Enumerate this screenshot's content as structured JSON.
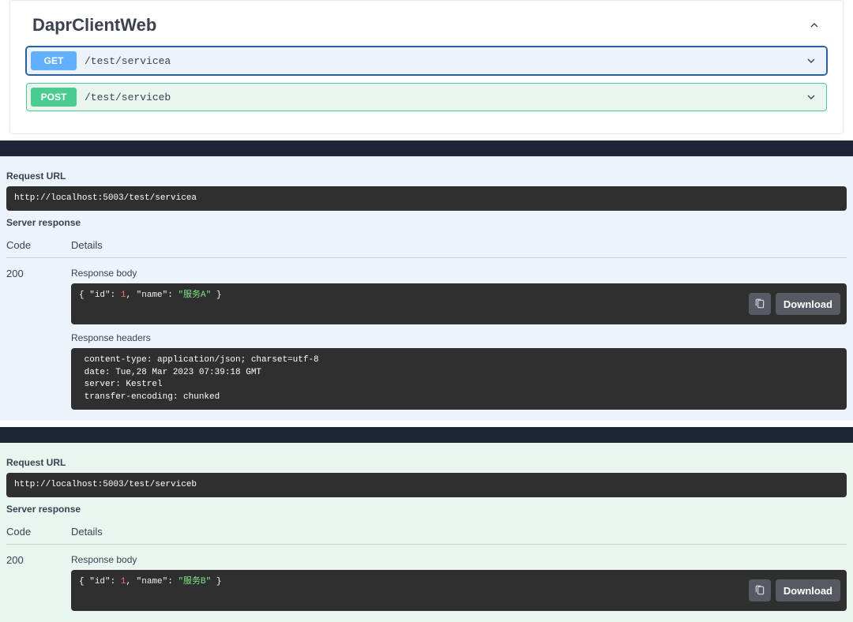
{
  "section": {
    "title": "DaprClientWeb"
  },
  "ops": [
    {
      "method": "GET",
      "path": "/test/servicea"
    },
    {
      "method": "POST",
      "path": "/test/serviceb"
    }
  ],
  "labels": {
    "request_url": "Request URL",
    "server_response": "Server response",
    "code": "Code",
    "details": "Details",
    "response_body": "Response body",
    "response_headers": "Response headers",
    "download": "Download"
  },
  "responses": [
    {
      "url": "http://localhost:5003/test/servicea",
      "code": "200",
      "body": {
        "id_key": "\"id\"",
        "id_val": "1",
        "name_key": "\"name\"",
        "name_val": "\"服务A\""
      },
      "headers": " content-type: application/json; charset=utf-8 \n date: Tue,28 Mar 2023 07:39:18 GMT \n server: Kestrel \n transfer-encoding: chunked "
    },
    {
      "url": "http://localhost:5003/test/serviceb",
      "code": "200",
      "body": {
        "id_key": "\"id\"",
        "id_val": "1",
        "name_key": "\"name\"",
        "name_val": "\"服务B\""
      }
    }
  ]
}
